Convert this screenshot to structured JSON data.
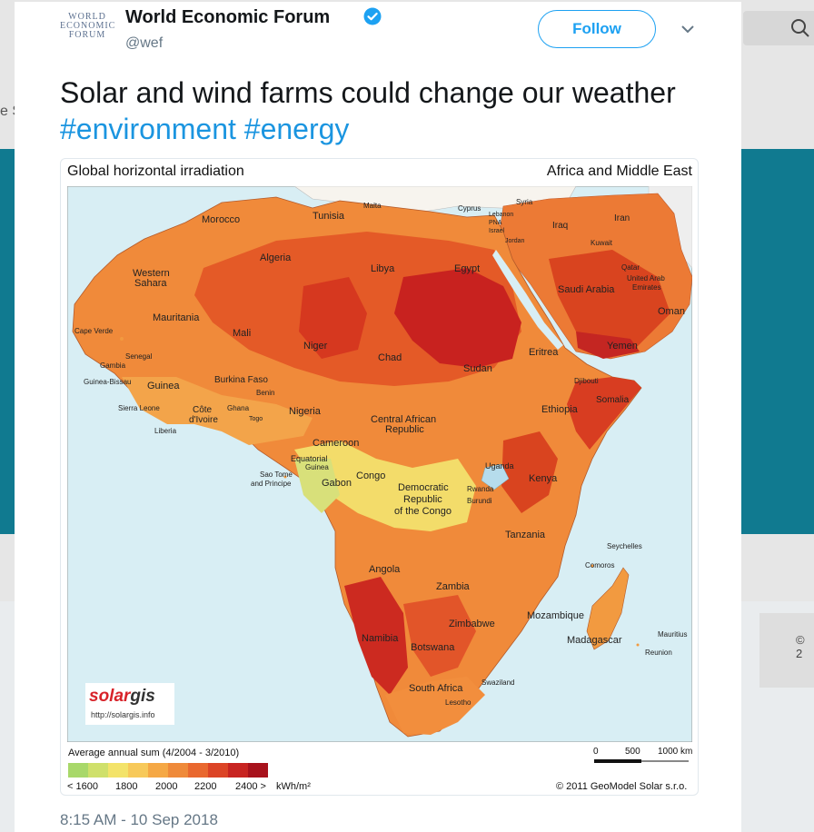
{
  "background": {
    "left_fragment": "e S",
    "right_fragment": "© 2"
  },
  "tweet": {
    "author_name": "World Economic Forum",
    "handle": "@wef",
    "avatar_lines": [
      "WORLD",
      "ECONOMIC",
      "FORUM"
    ],
    "follow_label": "Follow",
    "text_plain": "Solar and wind farms could change our weather",
    "hashtag_1": "#environment",
    "hashtag_2": "#energy",
    "timestamp": "8:15 AM - 10 Sep 2018"
  },
  "map_image": {
    "title_left": "Global horizontal irradiation",
    "title_right": "Africa and Middle East",
    "legend_title": "Average annual sum (4/2004 - 3/2010)",
    "legend_labels": [
      "< 1600",
      "1800",
      "2000",
      "2200",
      "2400 >"
    ],
    "legend_unit": "kWh/m²",
    "legend_colors": [
      "#a8d86a",
      "#cfe06b",
      "#f3e36a",
      "#f7c95a",
      "#f5a845",
      "#ef8a3a",
      "#e9682f",
      "#dc4426",
      "#c82421",
      "#a8121c"
    ],
    "scale_labels": [
      "0",
      "500",
      "1000 km"
    ],
    "copyright": "© 2011 GeoModel Solar s.r.o.",
    "logo_part1": "solar",
    "logo_part2": "gis",
    "logo_url": "http://solargis.info",
    "places": [
      "Morocco",
      "Tunisia",
      "Malta",
      "Cyprus",
      "Syria",
      "Lebanon",
      "PNA",
      "Israel",
      "Jordan",
      "Iraq",
      "Iran",
      "Kuwait",
      "Algeria",
      "Libya",
      "Egypt",
      "Qatar",
      "United Arab",
      "Emirates",
      "Saudi Arabia",
      "Oman",
      "Western",
      "Sahara",
      "Mauritania",
      "Cape Verde",
      "Mali",
      "Niger",
      "Chad",
      "Sudan",
      "Eritrea",
      "Yemen",
      "Senegal",
      "Gambia",
      "Guinea-Bissau",
      "Guinea",
      "Burkina Faso",
      "Benin",
      "Djibouti",
      "Somalia",
      "Sierra Leone",
      "Côte",
      "d'Ivoire",
      "Ghana",
      "Togo",
      "Liberia",
      "Nigeria",
      "Ethiopia",
      "Central African",
      "Republic",
      "Cameroon",
      "Equatorial",
      "Guinea",
      "Sao Tome",
      "and Principe",
      "Gabon",
      "Congo",
      "Democratic",
      "Republic",
      "of the Congo",
      "Uganda",
      "Kenya",
      "Rwanda",
      "Burundi",
      "Tanzania",
      "Seychelles",
      "Comoros",
      "Angola",
      "Zambia",
      "Mozambique",
      "Zimbabwe",
      "Namibia",
      "Botswana",
      "Madagascar",
      "Mauritius",
      "Reunion",
      "South Africa",
      "Swaziland",
      "Lesotho"
    ]
  }
}
